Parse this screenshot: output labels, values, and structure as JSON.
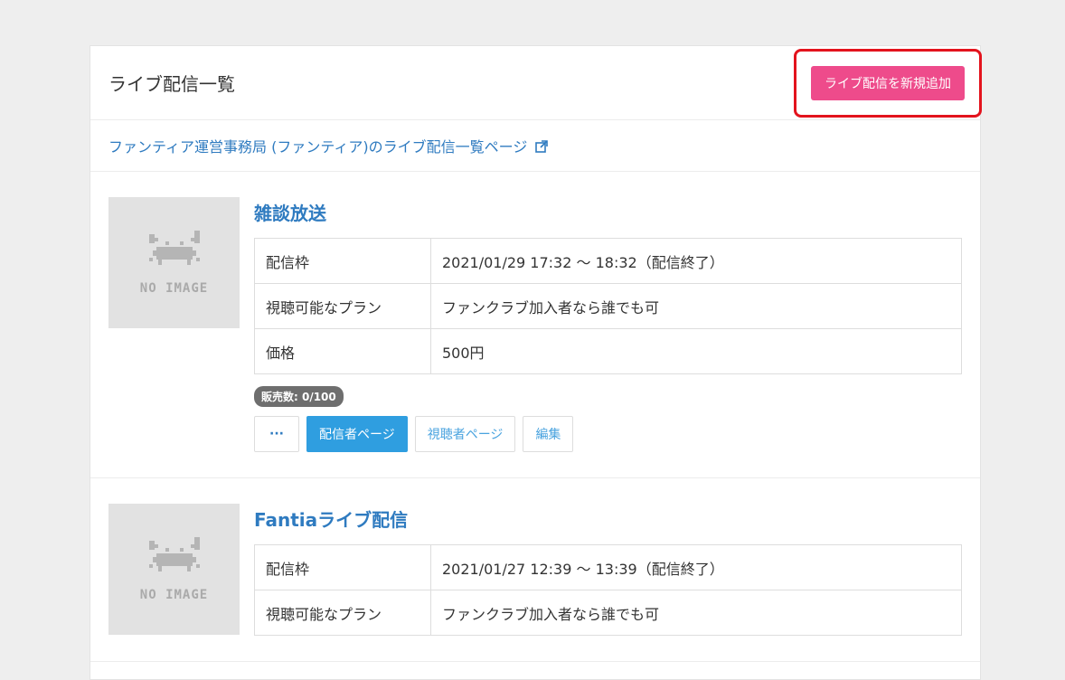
{
  "header": {
    "title": "ライブ配信一覧",
    "add_button": "ライブ配信を新規追加"
  },
  "link": {
    "text": "ファンティア運営事務局 (ファンティア)のライブ配信一覧ページ",
    "icon": "external-link-icon"
  },
  "thumb": {
    "text": "NO IMAGE",
    "icon": "crab-placeholder-icon"
  },
  "items": [
    {
      "title": "雑談放送",
      "rows": [
        {
          "key": "配信枠",
          "value": "2021/01/29 17:32 〜 18:32（配信終了）"
        },
        {
          "key": "視聴可能なプラン",
          "value": "ファンクラブ加入者なら誰でも可"
        },
        {
          "key": "価格",
          "value": "500円"
        }
      ],
      "badge": "販売数: 0/100",
      "buttons": {
        "more": "···",
        "streamer": "配信者ページ",
        "viewer": "視聴者ページ",
        "edit": "編集"
      }
    },
    {
      "title": "Fantiaライブ配信",
      "rows": [
        {
          "key": "配信枠",
          "value": "2021/01/27 12:39 〜 13:39（配信終了）"
        },
        {
          "key": "視聴可能なプラン",
          "value": "ファンクラブ加入者なら誰でも可"
        }
      ]
    }
  ],
  "colors": {
    "accent_pink": "#ee4b8b",
    "link_blue": "#2f7bc0",
    "primary_blue": "#2f9ee0",
    "highlight_red": "#e3131d"
  }
}
